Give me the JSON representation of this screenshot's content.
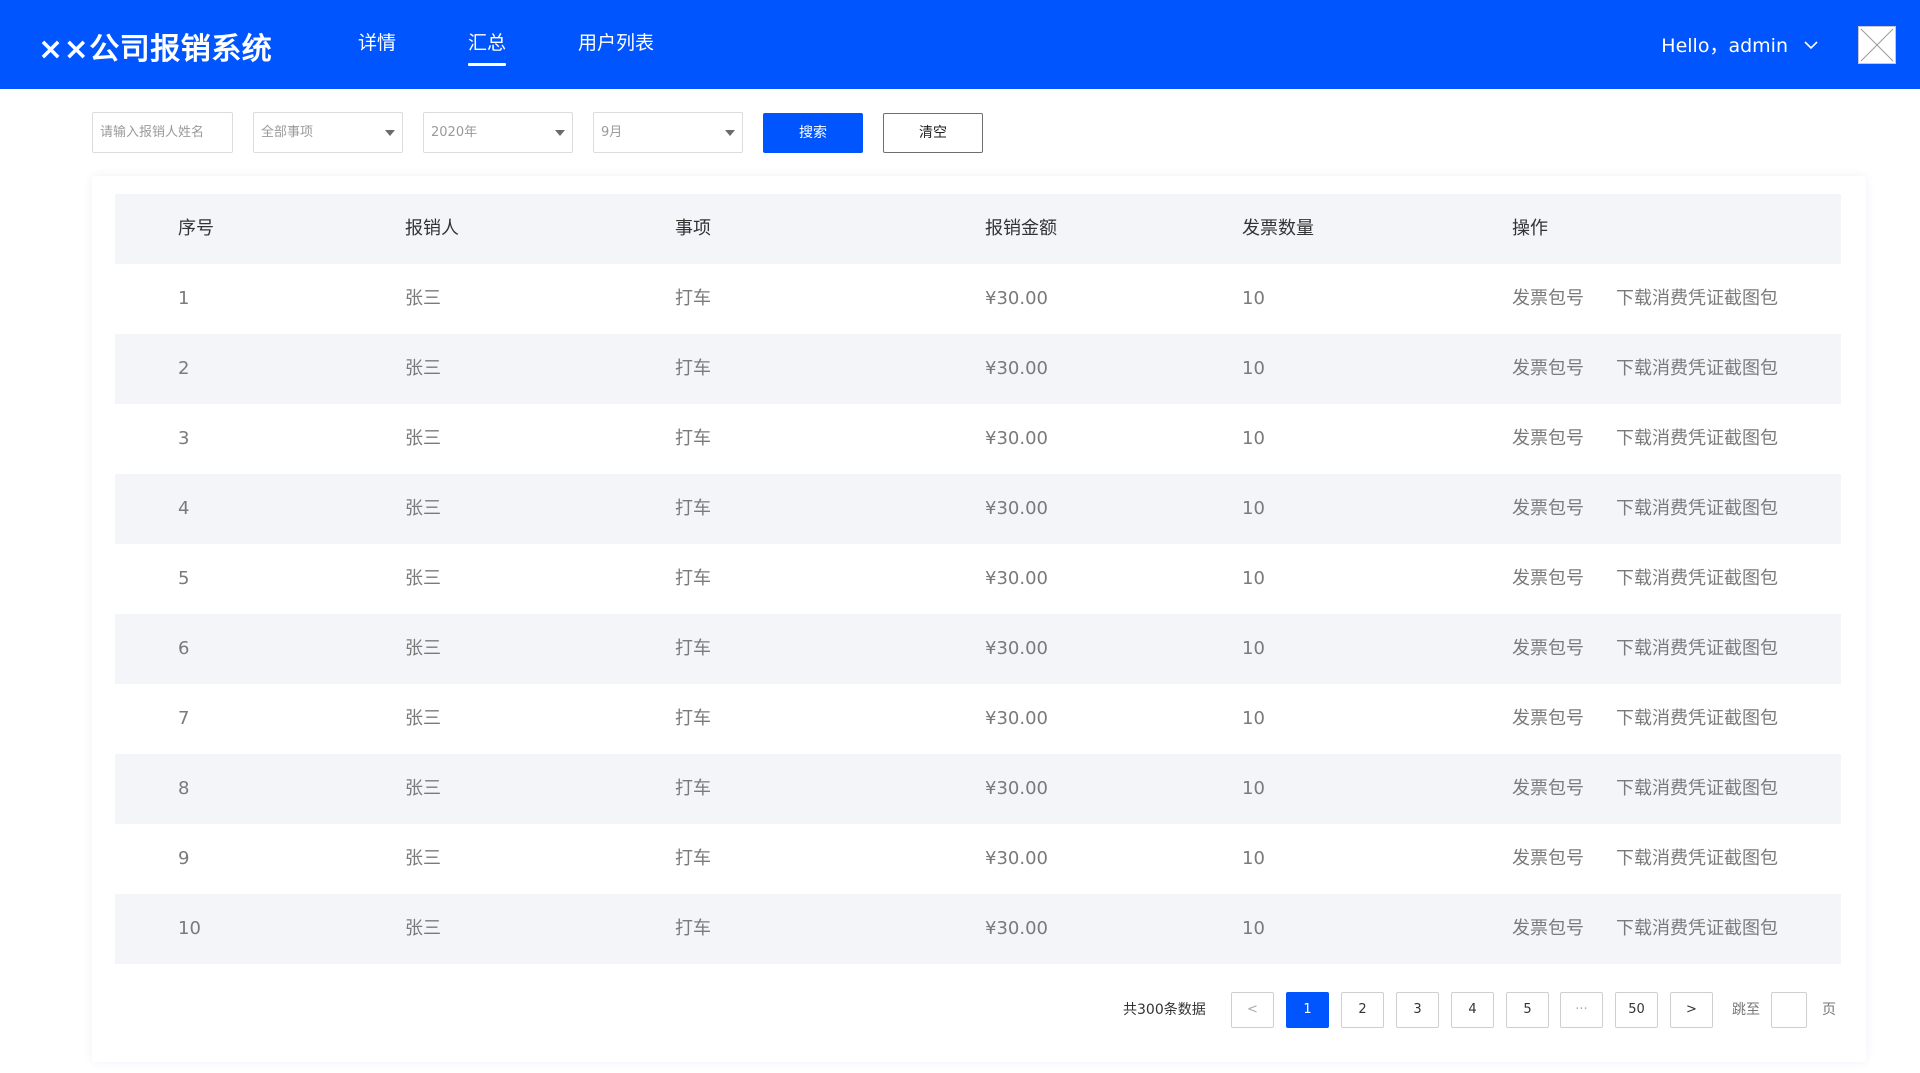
{
  "header": {
    "logo": "××公司报销系统",
    "nav": [
      {
        "label": "详情",
        "active": false
      },
      {
        "label": "汇总",
        "active": true
      },
      {
        "label": "用户列表",
        "active": false
      }
    ],
    "greeting": "Hello，admin",
    "accent_color": "#0055ff"
  },
  "filters": {
    "name_placeholder": "请输入报销人姓名",
    "item_select": "全部事项",
    "year_select": "2020年",
    "month_select": "9月",
    "search_label": "搜索",
    "clear_label": "清空"
  },
  "table": {
    "columns": [
      "序号",
      "报销人",
      "事项",
      "报销金额",
      "发票数量",
      "操作"
    ],
    "actions": [
      "发票包号",
      "下载消费凭证截图包"
    ],
    "rows": [
      {
        "index": "1",
        "person": "张三",
        "item": "打车",
        "amount": "¥30.00",
        "count": "10"
      },
      {
        "index": "2",
        "person": "张三",
        "item": "打车",
        "amount": "¥30.00",
        "count": "10"
      },
      {
        "index": "3",
        "person": "张三",
        "item": "打车",
        "amount": "¥30.00",
        "count": "10"
      },
      {
        "index": "4",
        "person": "张三",
        "item": "打车",
        "amount": "¥30.00",
        "count": "10"
      },
      {
        "index": "5",
        "person": "张三",
        "item": "打车",
        "amount": "¥30.00",
        "count": "10"
      },
      {
        "index": "6",
        "person": "张三",
        "item": "打车",
        "amount": "¥30.00",
        "count": "10"
      },
      {
        "index": "7",
        "person": "张三",
        "item": "打车",
        "amount": "¥30.00",
        "count": "10"
      },
      {
        "index": "8",
        "person": "张三",
        "item": "打车",
        "amount": "¥30.00",
        "count": "10"
      },
      {
        "index": "9",
        "person": "张三",
        "item": "打车",
        "amount": "¥30.00",
        "count": "10"
      },
      {
        "index": "10",
        "person": "张三",
        "item": "打车",
        "amount": "¥30.00",
        "count": "10"
      }
    ]
  },
  "pagination": {
    "total_text": "共300条数据",
    "prev": "<",
    "pages": [
      "1",
      "2",
      "3",
      "4",
      "5",
      "···",
      "50"
    ],
    "current": "1",
    "next": ">",
    "jump_label": "跳至",
    "page_unit": "页"
  }
}
